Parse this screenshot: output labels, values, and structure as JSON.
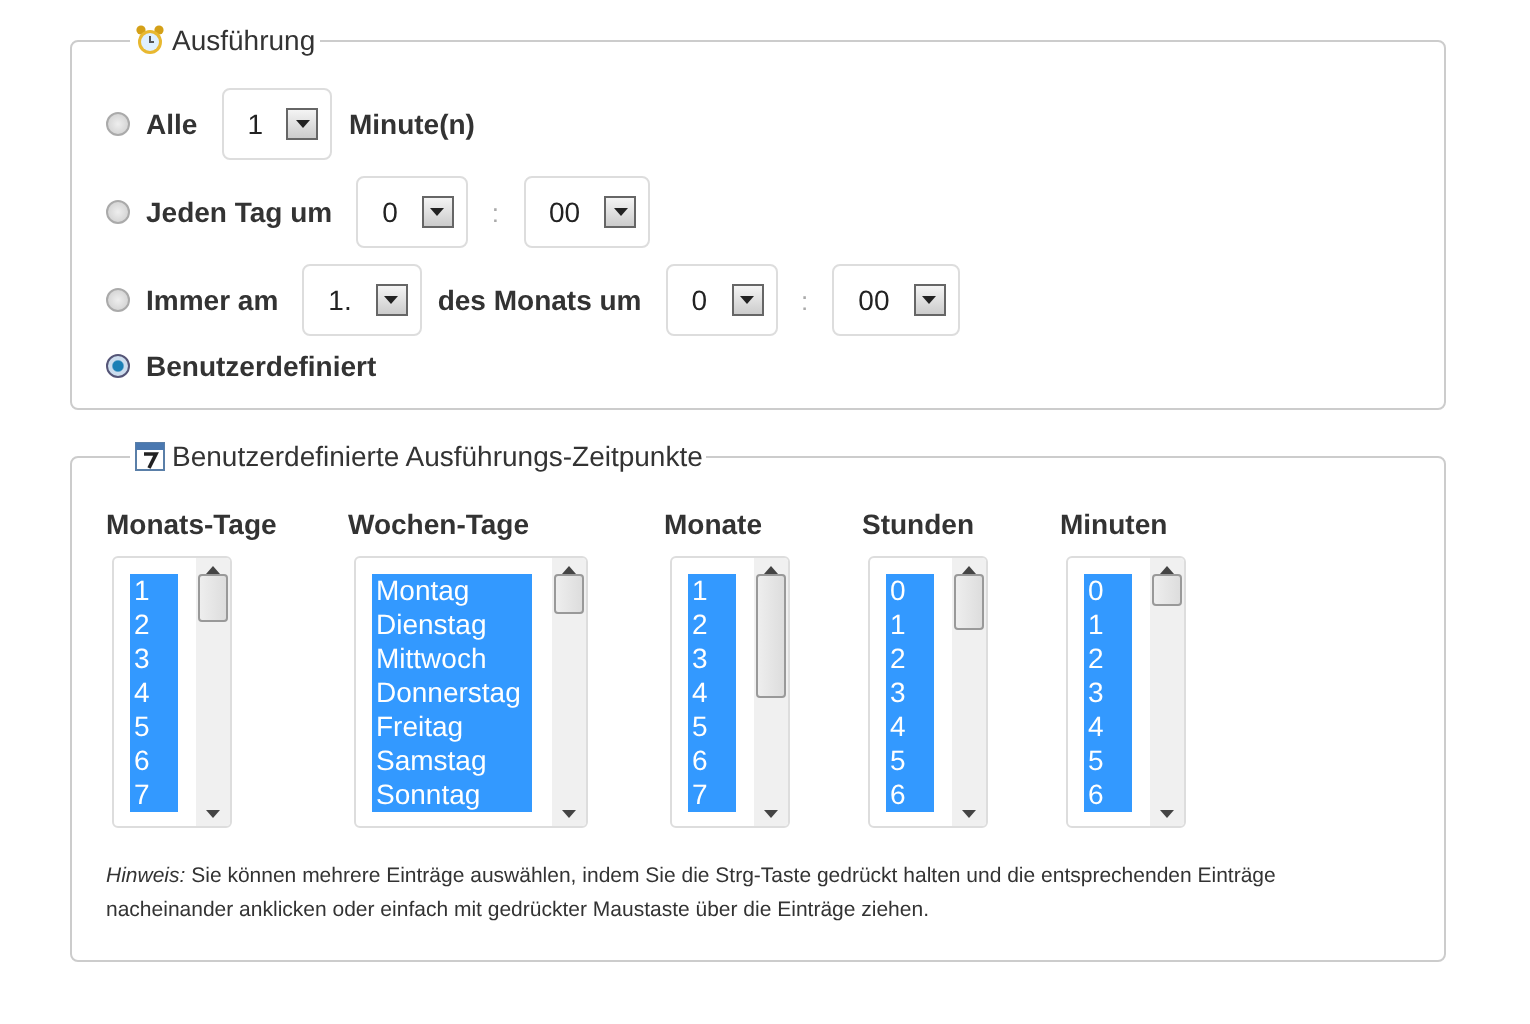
{
  "execution": {
    "title": "Ausführung",
    "options": [
      {
        "selected": false,
        "parts": [
          {
            "kind": "label",
            "text": "Alle"
          },
          {
            "kind": "select",
            "text": "1"
          },
          {
            "kind": "label",
            "text": "Minute(n)"
          }
        ]
      },
      {
        "selected": false,
        "parts": [
          {
            "kind": "label",
            "text": "Jeden Tag um"
          },
          {
            "kind": "select",
            "text": "0"
          },
          {
            "kind": "separator",
            "text": ":"
          },
          {
            "kind": "select",
            "text": "00"
          }
        ]
      },
      {
        "selected": false,
        "parts": [
          {
            "kind": "label",
            "text": "Immer am"
          },
          {
            "kind": "select",
            "text": "1."
          },
          {
            "kind": "label",
            "text": "des Monats um"
          },
          {
            "kind": "select",
            "text": "0"
          },
          {
            "kind": "separator",
            "text": ":"
          },
          {
            "kind": "select",
            "text": "00"
          }
        ]
      },
      {
        "selected": true,
        "parts": [
          {
            "kind": "label",
            "text": "Benutzerdefiniert"
          }
        ]
      }
    ]
  },
  "custom": {
    "title": "Benutzerdefinierte Ausführungs-Zeitpunkte",
    "lists": [
      {
        "heading": "Monats-Tage",
        "items": [
          {
            "text": "1",
            "selected": true
          },
          {
            "text": "2",
            "selected": true
          },
          {
            "text": "3",
            "selected": true
          },
          {
            "text": "4",
            "selected": true
          },
          {
            "text": "5",
            "selected": true
          },
          {
            "text": "6",
            "selected": true
          },
          {
            "text": "7",
            "selected": true
          }
        ]
      },
      {
        "heading": "Wochen-Tage",
        "items": [
          {
            "text": "Montag",
            "selected": true
          },
          {
            "text": "Dienstag",
            "selected": true
          },
          {
            "text": "Mittwoch",
            "selected": true
          },
          {
            "text": "Donnerstag",
            "selected": true
          },
          {
            "text": "Freitag",
            "selected": true
          },
          {
            "text": "Samstag",
            "selected": true
          },
          {
            "text": "Sonntag",
            "selected": true
          }
        ]
      },
      {
        "heading": "Monate",
        "items": [
          {
            "text": "1",
            "selected": true
          },
          {
            "text": "2",
            "selected": true
          },
          {
            "text": "3",
            "selected": true
          },
          {
            "text": "4",
            "selected": true
          },
          {
            "text": "5",
            "selected": true
          },
          {
            "text": "6",
            "selected": true
          },
          {
            "text": "7",
            "selected": true
          }
        ]
      },
      {
        "heading": "Stunden",
        "items": [
          {
            "text": "0",
            "selected": true
          },
          {
            "text": "1",
            "selected": true
          },
          {
            "text": "2",
            "selected": true
          },
          {
            "text": "3",
            "selected": true
          },
          {
            "text": "4",
            "selected": true
          },
          {
            "text": "5",
            "selected": true
          },
          {
            "text": "6",
            "selected": true
          }
        ]
      },
      {
        "heading": "Minuten",
        "items": [
          {
            "text": "0",
            "selected": true
          },
          {
            "text": "1",
            "selected": true
          },
          {
            "text": "2",
            "selected": true
          },
          {
            "text": "3",
            "selected": true
          },
          {
            "text": "4",
            "selected": true
          },
          {
            "text": "5",
            "selected": true
          },
          {
            "text": "6",
            "selected": true
          }
        ]
      }
    ],
    "hint": "*Hinweis:* Sie können mehrere Einträge auswählen, indem Sie die Strg-Taste gedrückt halten und die entsprechenden Einträge nacheinander anklicken oder einfach mit gedrückter Maustaste über die Einträge ziehen."
  }
}
